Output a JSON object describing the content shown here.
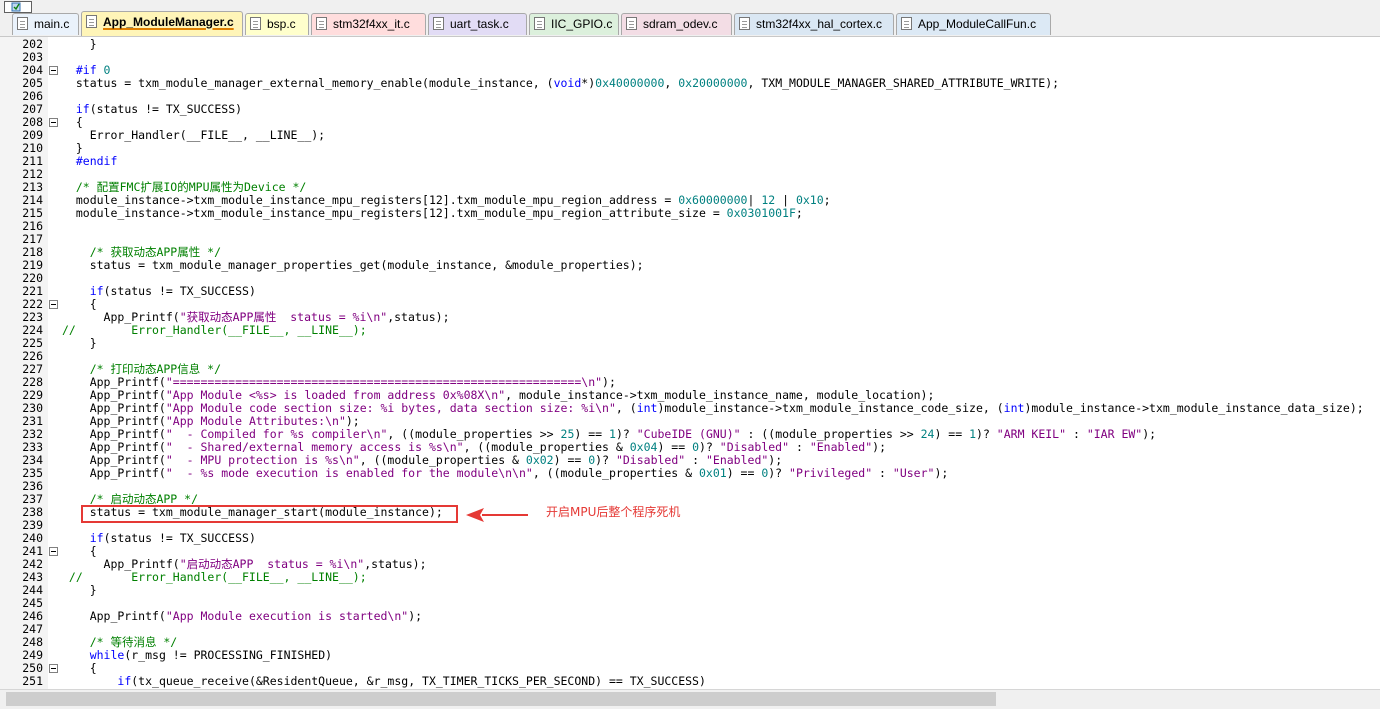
{
  "tabs": [
    {
      "label": "main.c",
      "bg": "#eaf2fb",
      "active": false
    },
    {
      "label": "App_ModuleManager.c",
      "bg": "#fff5b8",
      "active": true
    },
    {
      "label": "bsp.c",
      "bg": "#ffffcc",
      "active": false
    },
    {
      "label": "stm32f4xx_it.c",
      "bg": "#ffdddd",
      "active": false
    },
    {
      "label": "uart_task.c",
      "bg": "#e2dcf5",
      "active": false
    },
    {
      "label": "IIC_GPIO.c",
      "bg": "#dcf0dc",
      "active": false
    },
    {
      "label": "sdram_odev.c",
      "bg": "#f3dde5",
      "active": false
    },
    {
      "label": "stm32f4xx_hal_cortex.c",
      "bg": "#dae7f3",
      "active": false
    },
    {
      "label": "App_ModuleCallFun.c",
      "bg": "#dce9f5",
      "active": false
    }
  ],
  "colors": {
    "keyword": "#0000ff",
    "number": "#008080",
    "string": "#800080",
    "comment": "#008000",
    "annotation": "#e53935",
    "active_tab_underline": "#e08000"
  },
  "icons": {
    "toolbar": "file-toolbar-icon",
    "tab": "c-file-icon",
    "arrow": "red-arrow-left-icon"
  },
  "annotation": "开启MPU后整个程序死机",
  "code_lines": [
    {
      "n": "202",
      "fold": false,
      "segs": [
        [
          "t",
          "    }"
        ]
      ]
    },
    {
      "n": "203",
      "fold": false,
      "segs": []
    },
    {
      "n": "204",
      "fold": true,
      "segs": [
        [
          "k",
          "  #if "
        ],
        [
          "n",
          "0"
        ]
      ]
    },
    {
      "n": "205",
      "fold": false,
      "segs": [
        [
          "t",
          "  status = txm_module_manager_external_memory_enable(module_instance, ("
        ],
        [
          "k",
          "void"
        ],
        [
          "t",
          "*)"
        ],
        [
          "n",
          "0x40000000"
        ],
        [
          "t",
          ", "
        ],
        [
          "n",
          "0x20000000"
        ],
        [
          "t",
          ", TXM_MODULE_MANAGER_SHARED_ATTRIBUTE_WRITE);"
        ]
      ]
    },
    {
      "n": "206",
      "fold": false,
      "segs": []
    },
    {
      "n": "207",
      "fold": false,
      "segs": [
        [
          "t",
          "  "
        ],
        [
          "k",
          "if"
        ],
        [
          "t",
          "(status != TX_SUCCESS)"
        ]
      ]
    },
    {
      "n": "208",
      "fold": true,
      "segs": [
        [
          "t",
          "  {"
        ]
      ]
    },
    {
      "n": "209",
      "fold": false,
      "segs": [
        [
          "t",
          "    Error_Handler(__FILE__, __LINE__);"
        ]
      ]
    },
    {
      "n": "210",
      "fold": false,
      "segs": [
        [
          "t",
          "  }"
        ]
      ]
    },
    {
      "n": "211",
      "fold": false,
      "segs": [
        [
          "k",
          "  #endif"
        ]
      ]
    },
    {
      "n": "212",
      "fold": false,
      "segs": []
    },
    {
      "n": "213",
      "fold": false,
      "segs": [
        [
          "c",
          "  /* 配置FMC扩展IO的MPU属性为Device */"
        ]
      ]
    },
    {
      "n": "214",
      "fold": false,
      "segs": [
        [
          "t",
          "  module_instance->txm_module_instance_mpu_registers[12].txm_module_mpu_region_address = "
        ],
        [
          "n",
          "0x60000000"
        ],
        [
          "t",
          "| "
        ],
        [
          "n",
          "12"
        ],
        [
          "t",
          " | "
        ],
        [
          "n",
          "0x10"
        ],
        [
          "t",
          ";"
        ]
      ]
    },
    {
      "n": "215",
      "fold": false,
      "segs": [
        [
          "t",
          "  module_instance->txm_module_instance_mpu_registers[12].txm_module_mpu_region_attribute_size = "
        ],
        [
          "n",
          "0x0301001F"
        ],
        [
          "t",
          ";"
        ]
      ]
    },
    {
      "n": "216",
      "fold": false,
      "segs": []
    },
    {
      "n": "217",
      "fold": false,
      "segs": []
    },
    {
      "n": "218",
      "fold": false,
      "segs": [
        [
          "c",
          "    /* 获取动态APP属性 */"
        ]
      ]
    },
    {
      "n": "219",
      "fold": false,
      "segs": [
        [
          "t",
          "    status = txm_module_manager_properties_get(module_instance, &module_properties);"
        ]
      ]
    },
    {
      "n": "220",
      "fold": false,
      "segs": []
    },
    {
      "n": "221",
      "fold": false,
      "segs": [
        [
          "t",
          "    "
        ],
        [
          "k",
          "if"
        ],
        [
          "t",
          "(status != TX_SUCCESS)"
        ]
      ]
    },
    {
      "n": "222",
      "fold": true,
      "segs": [
        [
          "t",
          "    {"
        ]
      ]
    },
    {
      "n": "223",
      "fold": false,
      "segs": [
        [
          "t",
          "      App_Printf("
        ],
        [
          "s",
          "\"获取动态APP属性  status = %i\\n\""
        ],
        [
          "t",
          ",status);"
        ]
      ]
    },
    {
      "n": "224",
      "fold": false,
      "segs": [
        [
          "c",
          "//        Error_Handler(__FILE__, __LINE__);"
        ]
      ]
    },
    {
      "n": "225",
      "fold": false,
      "segs": [
        [
          "t",
          "    }"
        ]
      ]
    },
    {
      "n": "226",
      "fold": false,
      "segs": []
    },
    {
      "n": "227",
      "fold": false,
      "segs": [
        [
          "c",
          "    /* 打印动态APP信息 */"
        ]
      ]
    },
    {
      "n": "228",
      "fold": false,
      "segs": [
        [
          "t",
          "    App_Printf("
        ],
        [
          "s",
          "\"===========================================================\\n\""
        ],
        [
          "t",
          ");"
        ]
      ]
    },
    {
      "n": "229",
      "fold": false,
      "segs": [
        [
          "t",
          "    App_Printf("
        ],
        [
          "s",
          "\"App Module <%s> is loaded from address 0x%08X\\n\""
        ],
        [
          "t",
          ", module_instance->txm_module_instance_name, module_location);"
        ]
      ]
    },
    {
      "n": "230",
      "fold": false,
      "segs": [
        [
          "t",
          "    App_Printf("
        ],
        [
          "s",
          "\"App Module code section size: %i bytes, data section size: %i\\n\""
        ],
        [
          "t",
          ", ("
        ],
        [
          "k",
          "int"
        ],
        [
          "t",
          ")module_instance->txm_module_instance_code_size, ("
        ],
        [
          "k",
          "int"
        ],
        [
          "t",
          ")module_instance->txm_module_instance_data_size);"
        ]
      ]
    },
    {
      "n": "231",
      "fold": false,
      "segs": [
        [
          "t",
          "    App_Printf("
        ],
        [
          "s",
          "\"App Module Attributes:\\n\""
        ],
        [
          "t",
          ");"
        ]
      ]
    },
    {
      "n": "232",
      "fold": false,
      "segs": [
        [
          "t",
          "    App_Printf("
        ],
        [
          "s",
          "\"  - Compiled for %s compiler\\n\""
        ],
        [
          "t",
          ", ((module_properties >> "
        ],
        [
          "n",
          "25"
        ],
        [
          "t",
          ") == "
        ],
        [
          "n",
          "1"
        ],
        [
          "t",
          ")? "
        ],
        [
          "s",
          "\"CubeIDE (GNU)\""
        ],
        [
          "t",
          " : ((module_properties >> "
        ],
        [
          "n",
          "24"
        ],
        [
          "t",
          ") == "
        ],
        [
          "n",
          "1"
        ],
        [
          "t",
          ")? "
        ],
        [
          "s",
          "\"ARM KEIL\""
        ],
        [
          "t",
          " : "
        ],
        [
          "s",
          "\"IAR EW\""
        ],
        [
          "t",
          ");"
        ]
      ]
    },
    {
      "n": "233",
      "fold": false,
      "segs": [
        [
          "t",
          "    App_Printf("
        ],
        [
          "s",
          "\"  - Shared/external memory access is %s\\n\""
        ],
        [
          "t",
          ", ((module_properties & "
        ],
        [
          "n",
          "0x04"
        ],
        [
          "t",
          ") == "
        ],
        [
          "n",
          "0"
        ],
        [
          "t",
          ")? "
        ],
        [
          "s",
          "\"Disabled\""
        ],
        [
          "t",
          " : "
        ],
        [
          "s",
          "\"Enabled\""
        ],
        [
          "t",
          ");"
        ]
      ]
    },
    {
      "n": "234",
      "fold": false,
      "segs": [
        [
          "t",
          "    App_Printf("
        ],
        [
          "s",
          "\"  - MPU protection is %s\\n\""
        ],
        [
          "t",
          ", ((module_properties & "
        ],
        [
          "n",
          "0x02"
        ],
        [
          "t",
          ") == "
        ],
        [
          "n",
          "0"
        ],
        [
          "t",
          ")? "
        ],
        [
          "s",
          "\"Disabled\""
        ],
        [
          "t",
          " : "
        ],
        [
          "s",
          "\"Enabled\""
        ],
        [
          "t",
          ");"
        ]
      ]
    },
    {
      "n": "235",
      "fold": false,
      "segs": [
        [
          "t",
          "    App_Printf("
        ],
        [
          "s",
          "\"  - %s mode execution is enabled for the module\\n\\n\""
        ],
        [
          "t",
          ", ((module_properties & "
        ],
        [
          "n",
          "0x01"
        ],
        [
          "t",
          ") == "
        ],
        [
          "n",
          "0"
        ],
        [
          "t",
          ")? "
        ],
        [
          "s",
          "\"Privileged\""
        ],
        [
          "t",
          " : "
        ],
        [
          "s",
          "\"User\""
        ],
        [
          "t",
          ");"
        ]
      ]
    },
    {
      "n": "236",
      "fold": false,
      "segs": []
    },
    {
      "n": "237",
      "fold": false,
      "segs": [
        [
          "c",
          "    /* 启动动态APP */"
        ]
      ]
    },
    {
      "n": "238",
      "fold": false,
      "segs": [
        [
          "t",
          "    status = txm_module_manager_start(module_instance);"
        ]
      ]
    },
    {
      "n": "239",
      "fold": false,
      "segs": []
    },
    {
      "n": "240",
      "fold": false,
      "segs": [
        [
          "t",
          "    "
        ],
        [
          "k",
          "if"
        ],
        [
          "t",
          "(status != TX_SUCCESS)"
        ]
      ]
    },
    {
      "n": "241",
      "fold": true,
      "segs": [
        [
          "t",
          "    {"
        ]
      ]
    },
    {
      "n": "242",
      "fold": false,
      "segs": [
        [
          "t",
          "      App_Printf("
        ],
        [
          "s",
          "\"启动动态APP  status = %i\\n\""
        ],
        [
          "t",
          ",status);"
        ]
      ]
    },
    {
      "n": "243",
      "fold": false,
      "segs": [
        [
          "c",
          " //       Error_Handler(__FILE__, __LINE__);"
        ]
      ]
    },
    {
      "n": "244",
      "fold": false,
      "segs": [
        [
          "t",
          "    }"
        ]
      ]
    },
    {
      "n": "245",
      "fold": false,
      "segs": []
    },
    {
      "n": "246",
      "fold": false,
      "segs": [
        [
          "t",
          "    App_Printf("
        ],
        [
          "s",
          "\"App Module execution is started\\n\""
        ],
        [
          "t",
          ");"
        ]
      ]
    },
    {
      "n": "247",
      "fold": false,
      "segs": []
    },
    {
      "n": "248",
      "fold": false,
      "segs": [
        [
          "c",
          "    /* 等待消息 */"
        ]
      ]
    },
    {
      "n": "249",
      "fold": false,
      "segs": [
        [
          "t",
          "    "
        ],
        [
          "k",
          "while"
        ],
        [
          "t",
          "(r_msg != PROCESSING_FINISHED)"
        ]
      ]
    },
    {
      "n": "250",
      "fold": true,
      "segs": [
        [
          "t",
          "    {"
        ]
      ]
    },
    {
      "n": "251",
      "fold": false,
      "segs": [
        [
          "t",
          "        "
        ],
        [
          "k",
          "if"
        ],
        [
          "t",
          "(tx_queue_receive(&ResidentQueue, &r_msg, TX_TIMER_TICKS_PER_SECOND) == TX_SUCCESS)"
        ]
      ]
    }
  ]
}
